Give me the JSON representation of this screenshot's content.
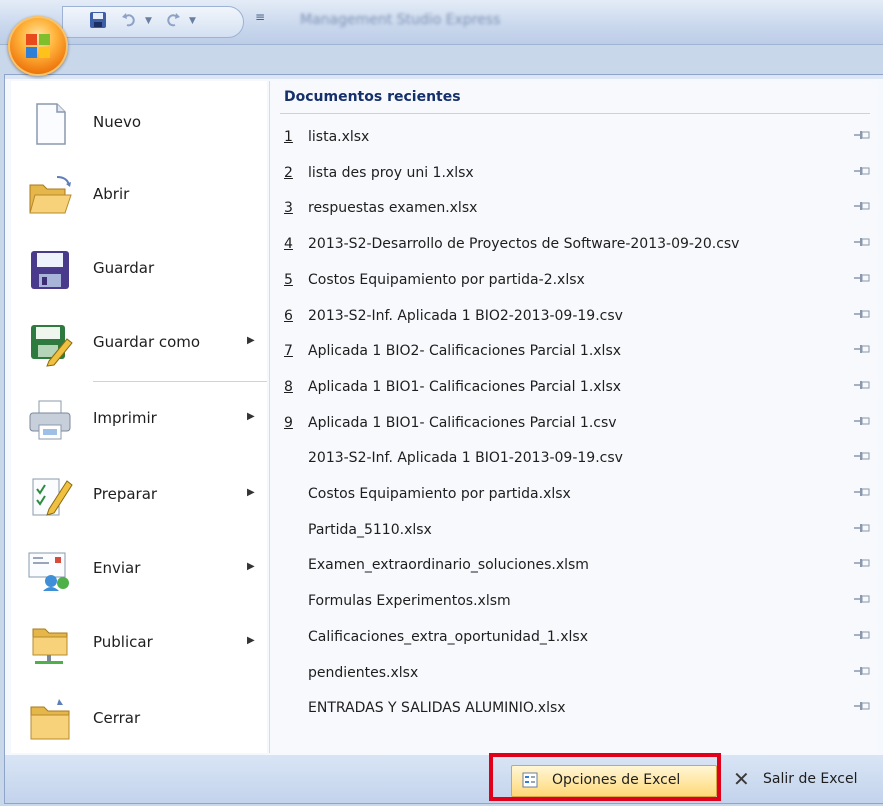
{
  "titlebar": {
    "title": "Management Studio Express"
  },
  "quick_access": {
    "customize_glyph": "≡"
  },
  "menu": {
    "commands": [
      {
        "id": "new",
        "label": "Nuevo",
        "icon": "new-document-icon",
        "submenu": false
      },
      {
        "id": "open",
        "label": "Abrir",
        "icon": "open-folder-icon",
        "submenu": false
      },
      {
        "id": "save",
        "label": "Guardar",
        "icon": "save-disk-icon",
        "submenu": false
      },
      {
        "id": "save-as",
        "label": "Guardar como",
        "icon": "save-as-icon",
        "submenu": true
      },
      {
        "id": "print",
        "label": "Imprimir",
        "icon": "printer-icon",
        "submenu": true
      },
      {
        "id": "prepare",
        "label": "Preparar",
        "icon": "prepare-document-icon",
        "submenu": true
      },
      {
        "id": "send",
        "label": "Enviar",
        "icon": "send-icon",
        "submenu": true
      },
      {
        "id": "publish",
        "label": "Publicar",
        "icon": "publish-icon",
        "submenu": true
      },
      {
        "id": "close",
        "label": "Cerrar",
        "icon": "close-folder-icon",
        "submenu": false
      }
    ],
    "submenu_arrow": "▶"
  },
  "recent": {
    "title": "Documentos recientes",
    "documents": [
      {
        "num": "1",
        "name": "lista.xlsx"
      },
      {
        "num": "2",
        "name": "lista des proy uni 1.xlsx"
      },
      {
        "num": "3",
        "name": "respuestas examen.xlsx"
      },
      {
        "num": "4",
        "name": "2013-S2-Desarrollo de Proyectos de Software-2013-09-20.csv"
      },
      {
        "num": "5",
        "name": "Costos Equipamiento por partida-2.xlsx"
      },
      {
        "num": "6",
        "name": "2013-S2-Inf. Aplicada 1 BIO2-2013-09-19.csv"
      },
      {
        "num": "7",
        "name": "Aplicada 1 BIO2- Calificaciones Parcial 1.xlsx"
      },
      {
        "num": "8",
        "name": "Aplicada 1 BIO1- Calificaciones Parcial 1.xlsx"
      },
      {
        "num": "9",
        "name": "Aplicada 1 BIO1- Calificaciones Parcial 1.csv"
      },
      {
        "num": "",
        "name": "2013-S2-Inf. Aplicada 1 BIO1-2013-09-19.csv"
      },
      {
        "num": "",
        "name": "Costos Equipamiento por partida.xlsx"
      },
      {
        "num": "",
        "name": "Partida_5110.xlsx"
      },
      {
        "num": "",
        "name": "Examen_extraordinario_soluciones.xlsm"
      },
      {
        "num": "",
        "name": "Formulas Experimentos.xlsm"
      },
      {
        "num": "",
        "name": "Calificaciones_extra_oportunidad_1.xlsx"
      },
      {
        "num": "",
        "name": "pendientes.xlsx"
      },
      {
        "num": "",
        "name": "ENTRADAS Y SALIDAS ALUMINIO.xlsx"
      }
    ]
  },
  "footer": {
    "options_label": "Opciones de Excel",
    "exit_label": "Salir de Excel",
    "exit_glyph": "✕"
  },
  "colors": {
    "highlight": "#e0001a",
    "title": "#15306b"
  }
}
